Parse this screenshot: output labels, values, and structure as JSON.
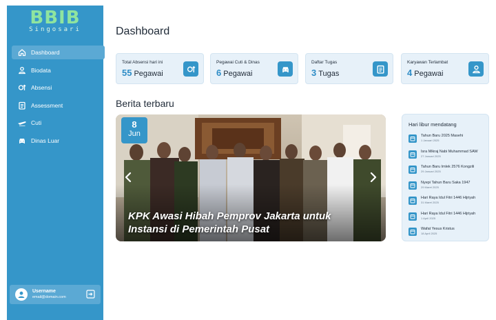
{
  "brand": {
    "name": "BBIB",
    "subtitle": "Singosari"
  },
  "sidebar": {
    "items": [
      {
        "label": "Dashboard",
        "icon": "home-icon",
        "active": true
      },
      {
        "label": "Biodata",
        "icon": "user-icon",
        "active": false
      },
      {
        "label": "Absensi",
        "icon": "attendance-icon",
        "active": false
      },
      {
        "label": "Assessment",
        "icon": "clipboard-icon",
        "active": false
      },
      {
        "label": "Cuti",
        "icon": "airplane-icon",
        "active": false
      },
      {
        "label": "Dinas Luar",
        "icon": "car-icon",
        "active": false
      }
    ],
    "user": {
      "name": "Username",
      "email": "email@domain.com"
    }
  },
  "page": {
    "title": "Dashboard"
  },
  "cards": [
    {
      "label": "Total Absensi hari ini",
      "value": "55",
      "unit": "Pegawai",
      "icon": "attendance-icon"
    },
    {
      "label": "Pegawai Cuti & Dinas",
      "value": "6",
      "unit": "Pegawai",
      "icon": "car-icon"
    },
    {
      "label": "Daftar Tugas",
      "value": "3",
      "unit": "Tugas",
      "icon": "clipboard-icon"
    },
    {
      "label": "Karyawan Terlambat",
      "value": "4",
      "unit": "Pegawai",
      "icon": "user-icon"
    }
  ],
  "news": {
    "heading": "Berita terbaru",
    "day": "8",
    "month": "Jun",
    "title": "KPK Awasi Hibah Pemprov Jakarta untuk Instansi di Pemerintah Pusat"
  },
  "holidays": {
    "title": "Hari libur mendatang",
    "items": [
      {
        "name": "Tahun Baru 2025 Masehi",
        "date": "1 Januari 2025"
      },
      {
        "name": "Isra Mikraj Nabi Muhammad SAW",
        "date": "27 Januari 2025"
      },
      {
        "name": "Tahun Baru Imlek 2576 Kongzili",
        "date": "29 Januari 2025"
      },
      {
        "name": "Nyepi Tahun Baru Saka 1947",
        "date": "29 Maret 2025"
      },
      {
        "name": "Hari Raya Idul Fitri 1446 Hijriyah",
        "date": "31 Maret 2025"
      },
      {
        "name": "Hari Raya Idul Fitri 1446 Hijriyah",
        "date": "1 April 2025"
      },
      {
        "name": "Wafat Yesus Kristus",
        "date": "18 April 2025"
      }
    ]
  }
}
